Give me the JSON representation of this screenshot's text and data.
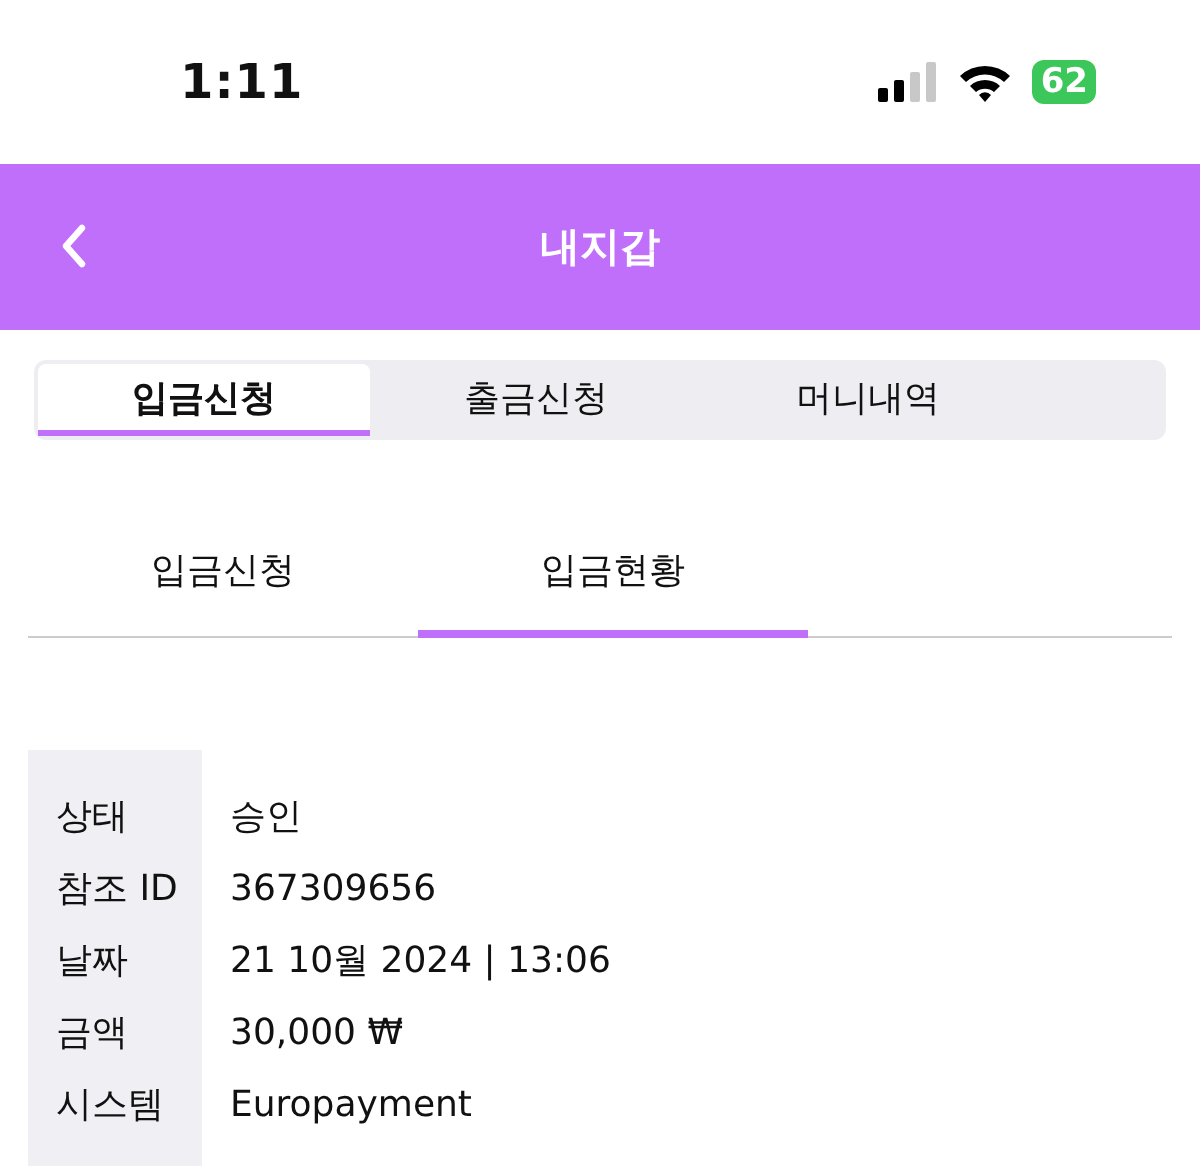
{
  "status_bar": {
    "time": "1:11",
    "battery": "62"
  },
  "header": {
    "title": "내지갑"
  },
  "segments": [
    {
      "label": "입금신청",
      "selected": true
    },
    {
      "label": "출금신청",
      "selected": false
    },
    {
      "label": "머니내역",
      "selected": false
    }
  ],
  "sub_tabs": [
    {
      "label": "입금신청",
      "selected": false
    },
    {
      "label": "입금현황",
      "selected": true
    }
  ],
  "details": [
    {
      "label": "상태",
      "value": "승인"
    },
    {
      "label": "참조 ID",
      "value": "367309656"
    },
    {
      "label": "날짜",
      "value": "21 10월 2024 | 13:06"
    },
    {
      "label": "금액",
      "value": "30,000 ₩"
    },
    {
      "label": "시스템",
      "value": "Europayment"
    }
  ]
}
